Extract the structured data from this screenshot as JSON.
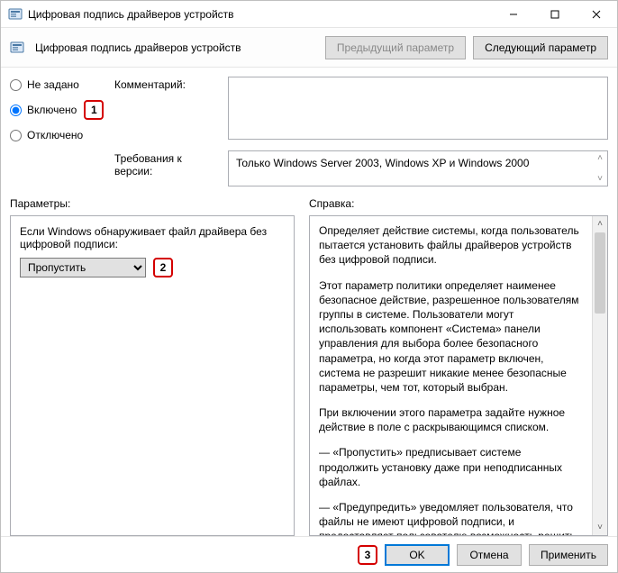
{
  "window": {
    "title": "Цифровая подпись драйверов устройств"
  },
  "toolbar": {
    "title": "Цифровая подпись драйверов устройств",
    "prev": "Предыдущий параметр",
    "next": "Следующий параметр"
  },
  "state_radios": {
    "not_configured": "Не задано",
    "enabled": "Включено",
    "disabled": "Отключено"
  },
  "labels": {
    "comment": "Комментарий:",
    "version_req": "Требования к версии:",
    "parameters": "Параметры:",
    "help": "Справка:"
  },
  "version_text": "Только Windows Server 2003, Windows XP и Windows 2000",
  "parameters_panel": {
    "prompt": "Если Windows обнаруживает файл драйвера без цифровой подписи:",
    "select_value": "Пропустить"
  },
  "help_paragraphs": [
    "Определяет действие системы, когда пользователь пытается установить файлы драйверов устройств без цифровой подписи.",
    "Этот параметр политики определяет наименее безопасное действие, разрешенное пользователям группы в системе. Пользователи могут использовать компонент «Система» панели управления для выбора более безопасного параметра, но когда этот параметр включен, система не разрешит никакие менее безопасные параметры, чем тот, который выбран.",
    "При включении этого параметра задайте нужное действие в поле с раскрывающимся списком.",
    "— «Пропустить» предписывает системе продолжить установку даже при неподписанных файлах.",
    "— «Предупредить» уведомляет пользователя, что файлы не имеют цифровой подписи, и предоставляет пользователю возможность решить, остановить установку или тот,"
  ],
  "footer": {
    "ok": "OK",
    "cancel": "Отмена",
    "apply": "Применить"
  },
  "callouts": {
    "one": "1",
    "two": "2",
    "three": "3"
  }
}
